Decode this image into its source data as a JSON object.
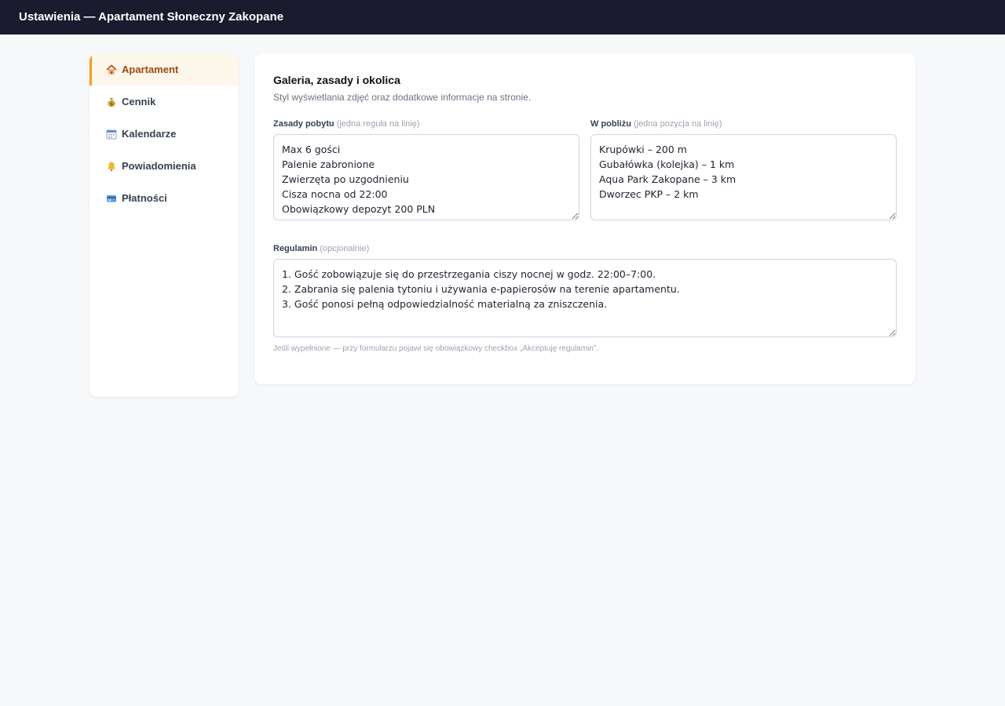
{
  "header": {
    "title": "Ustawienia — Apartament Słoneczny Zakopane"
  },
  "sidebar": {
    "items": [
      {
        "label": "Apartament",
        "icon": "house-icon",
        "active": true
      },
      {
        "label": "Cennik",
        "icon": "money-bag-icon",
        "active": false
      },
      {
        "label": "Kalendarze",
        "icon": "calendar-icon",
        "active": false
      },
      {
        "label": "Powiadomienia",
        "icon": "bell-icon",
        "active": false
      },
      {
        "label": "Płatności",
        "icon": "credit-card-icon",
        "active": false
      }
    ]
  },
  "main": {
    "title": "Galeria, zasady i okolica",
    "description": "Styl wyświetlania zdjęć oraz dodatkowe informacje na stronie.",
    "rules": {
      "label": "Zasady pobytu",
      "hint": "(jedna reguła na linię)",
      "value": "Max 6 gości\nPalenie zabronione\nZwierzęta po uzgodnieniu\nCisza nocna od 22:00\nObowiązkowy depozyt 200 PLN"
    },
    "nearby": {
      "label": "W pobliżu",
      "hint": "(jedna pozycja na linię)",
      "value": "Krupówki – 200 m\nGubałówka (kolejka) – 1 km\nAqua Park Zakopane – 3 km\nDworzec PKP – 2 km"
    },
    "terms": {
      "label": "Regulamin",
      "hint": "(opcjonalnie)",
      "value": "1. Gość zobowiązuje się do przestrzegania ciszy nocnej w godz. 22:00–7:00.\n2. Zabrania się palenia tytoniu i używania e-papierosów na terenie apartamentu.\n3. Gość ponosi pełną odpowiedzialność materialną za zniszczenia.",
      "help": "Jeśli wypełnione — przy formularzu pojawi się obowiązkowy checkbox „Akceptuję regulamin”."
    }
  },
  "colors": {
    "header_bg": "#1b1b2f",
    "active_accent": "#f0a020",
    "active_text": "#9a4a12",
    "active_bg": "#fdf6ea"
  }
}
